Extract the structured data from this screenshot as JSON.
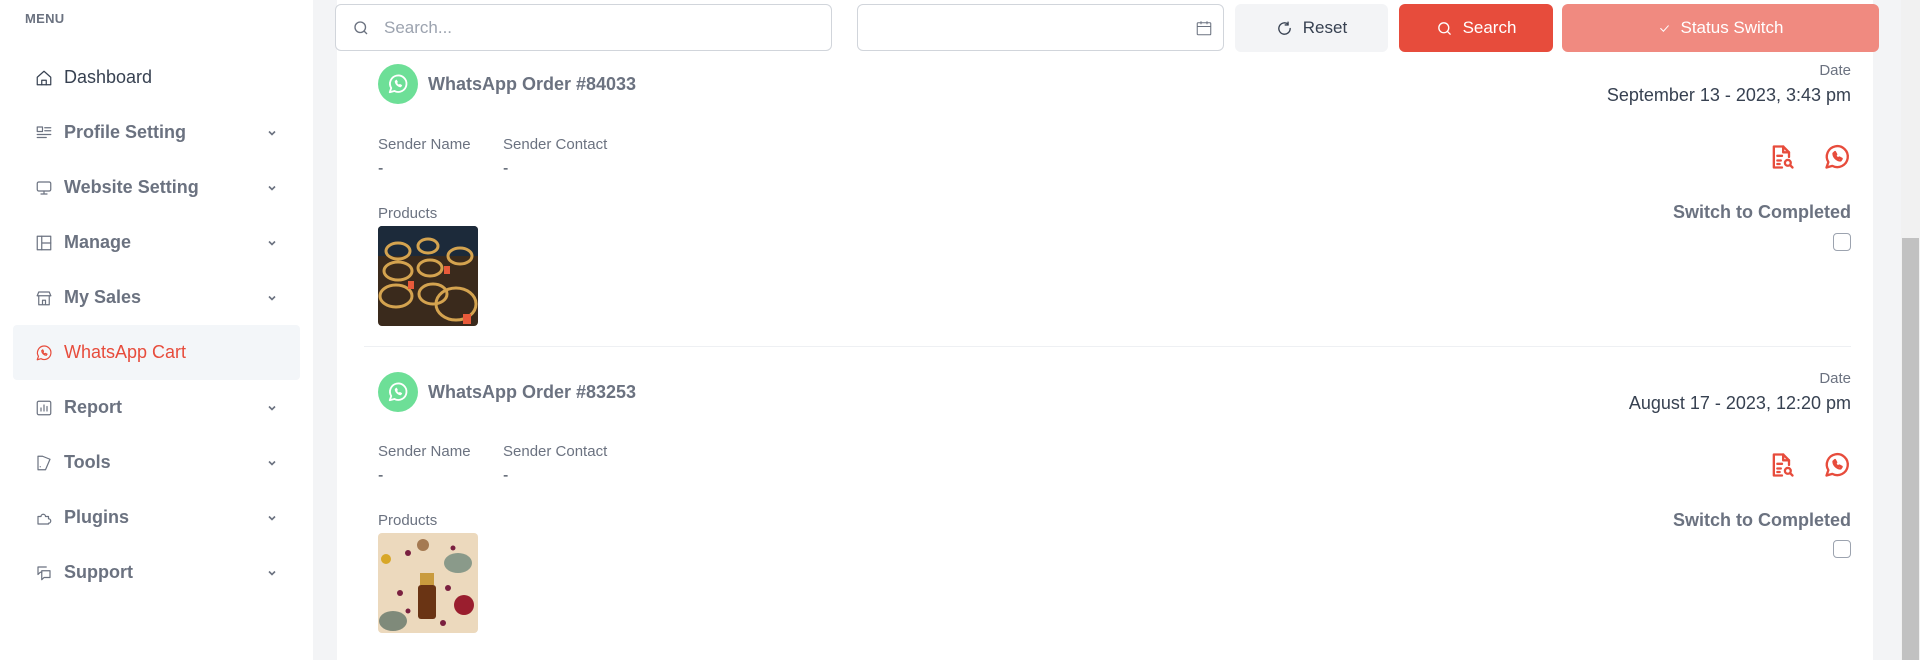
{
  "sidebar": {
    "menu_title": "MENU",
    "items": [
      {
        "label": "Dashboard",
        "icon": "home-icon",
        "has_chevron": false,
        "active": false
      },
      {
        "label": "Profile Setting",
        "icon": "profile-list-icon",
        "has_chevron": true,
        "active": false
      },
      {
        "label": "Website Setting",
        "icon": "monitor-icon",
        "has_chevron": true,
        "active": false
      },
      {
        "label": "Manage",
        "icon": "layout-icon",
        "has_chevron": true,
        "active": false
      },
      {
        "label": "My Sales",
        "icon": "store-icon",
        "has_chevron": true,
        "active": false
      },
      {
        "label": "WhatsApp Cart",
        "icon": "whatsapp-icon",
        "has_chevron": false,
        "active": true
      },
      {
        "label": "Report",
        "icon": "chart-icon",
        "has_chevron": true,
        "active": false
      },
      {
        "label": "Tools",
        "icon": "tools-icon",
        "has_chevron": true,
        "active": false
      },
      {
        "label": "Plugins",
        "icon": "puzzle-icon",
        "has_chevron": true,
        "active": false
      },
      {
        "label": "Support",
        "icon": "chat-icon",
        "has_chevron": true,
        "active": false
      }
    ]
  },
  "toolbar": {
    "search_placeholder": "Search...",
    "search_value": "",
    "date_value": "",
    "reset_label": "Reset",
    "search_label": "Search",
    "status_switch_label": "Status Switch"
  },
  "orders": [
    {
      "title": "WhatsApp Order #84033",
      "sender_name_label": "Sender Name",
      "sender_name": "-",
      "sender_contact_label": "Sender Contact",
      "sender_contact": "-",
      "products_label": "Products",
      "product_image": "incense coils product photo",
      "date_label": "Date",
      "date": "September 13 - 2023, 3:43 pm",
      "switch_label": "Switch to Completed",
      "completed": false
    },
    {
      "title": "WhatsApp Order #83253",
      "sender_name_label": "Sender Name",
      "sender_name": "-",
      "sender_contact_label": "Sender Contact",
      "sender_contact": "-",
      "products_label": "Products",
      "product_image": "essential oil bottle with petals product photo",
      "date_label": "Date",
      "date": "August 17 - 2023, 12:20 pm",
      "switch_label": "Switch to Completed",
      "completed": false
    }
  ],
  "colors": {
    "accent": "#e74c3c",
    "accent_light": "#f08a80",
    "whatsapp_green": "#6ddf97",
    "text_muted": "#6b7280",
    "text_dark": "#374151"
  }
}
